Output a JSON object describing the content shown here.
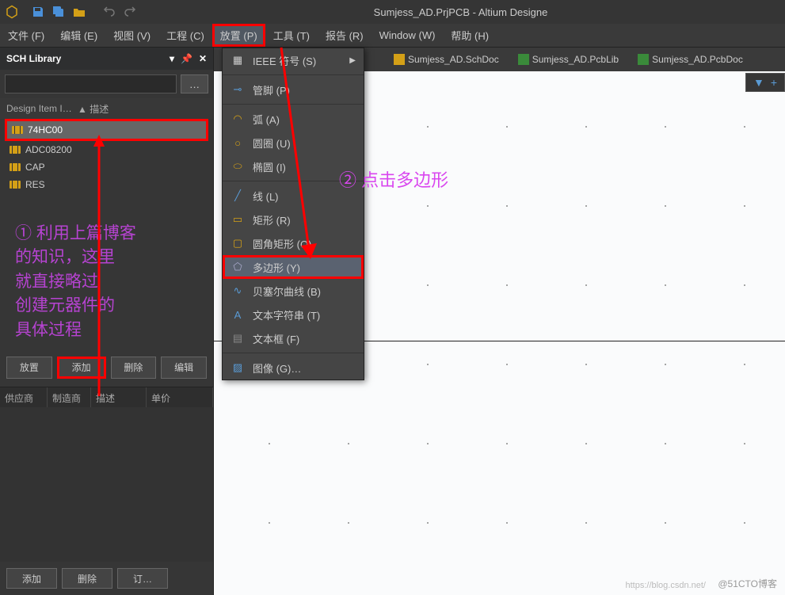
{
  "app": {
    "title": "Sumjess_AD.PrjPCB - Altium Designe"
  },
  "menubar": {
    "file": "文件 (F)",
    "edit": "编辑 (E)",
    "view": "视图 (V)",
    "proj": "工程 (C)",
    "place": "放置 (P)",
    "tools": "工具 (T)",
    "report": "报告 (R)",
    "window": "Window (W)",
    "help": "帮助 (H)"
  },
  "panel": {
    "title": "SCH Library",
    "search_btn": "…",
    "col1": "Design Item I…",
    "col2": "描述",
    "items": [
      "74HC00",
      "ADC08200",
      "CAP",
      "RES"
    ],
    "btns": {
      "place": "放置",
      "add": "添加",
      "del": "删除",
      "edit": "编辑"
    },
    "sup": {
      "c1": "供应商",
      "c2": "制造商",
      "c3": "描述",
      "c4": "单价"
    },
    "btns2": {
      "add": "添加",
      "del": "删除",
      "order": "订…"
    }
  },
  "tabs": {
    "t1": "Sumjess_AD.SchDoc",
    "t2": "Sumjess_AD.PcbLib",
    "t3": "Sumjess_AD.PcbDoc"
  },
  "dropdown": {
    "ieee": "IEEE 符号 (S)",
    "pin": "管脚 (P)",
    "arc": "弧 (A)",
    "circle": "圆圈 (U)",
    "ellipse": "椭圆 (I)",
    "line": "线 (L)",
    "rect": "矩形 (R)",
    "roundrect": "圆角矩形 (O)",
    "poly": "多边形 (Y)",
    "bezier": "贝塞尔曲线 (B)",
    "text": "文本字符串 (T)",
    "textbox": "文本框 (F)",
    "image": "图像 (G)…"
  },
  "annotations": {
    "a1_line1": "① 利用上篇博客",
    "a1_line2": "的知识，这里",
    "a1_line3": "就直接略过",
    "a1_line4": "创建元器件的",
    "a1_line5": "具体过程",
    "a2": "② 点击多边形"
  },
  "watermark": "@51CTO博客",
  "watermark2": "https://blog.csdn.net/"
}
